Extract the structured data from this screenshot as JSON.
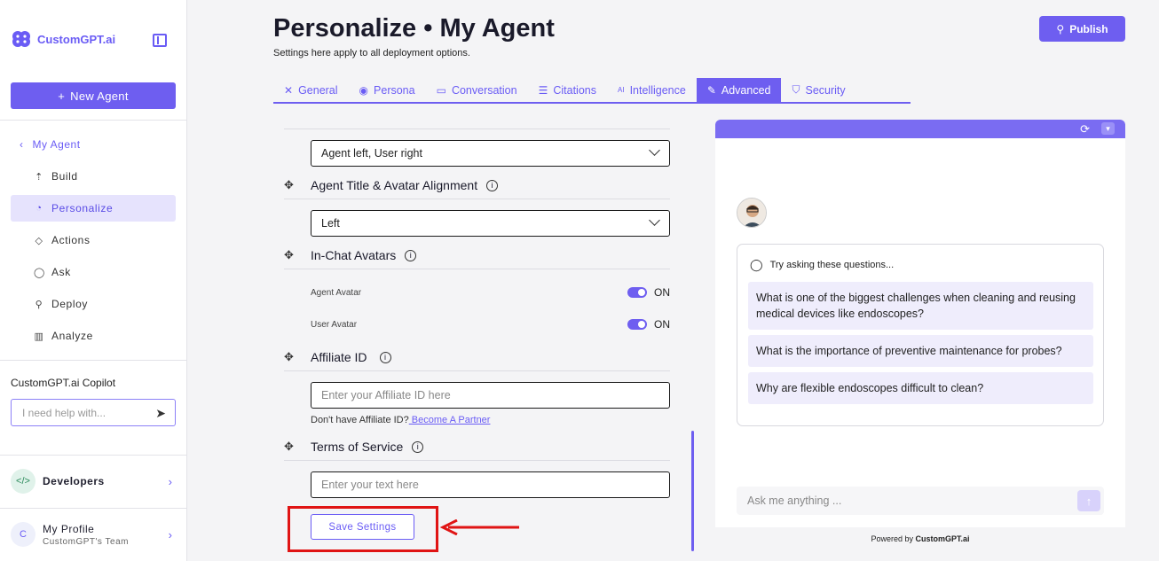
{
  "sidebar": {
    "logo_text": "CustomGPT.ai",
    "new_agent_label": "New Agent",
    "back_label": "My Agent",
    "items": [
      {
        "label": "Build",
        "icon": "build-icon"
      },
      {
        "label": "Personalize",
        "icon": "palette-icon"
      },
      {
        "label": "Actions",
        "icon": "actions-icon"
      },
      {
        "label": "Ask",
        "icon": "chat-icon"
      },
      {
        "label": "Deploy",
        "icon": "rocket-icon"
      },
      {
        "label": "Analyze",
        "icon": "chart-icon"
      }
    ],
    "active_item": "Personalize",
    "copilot_title": "CustomGPT.ai Copilot",
    "copilot_placeholder": "I need help with...",
    "developers_label": "Developers",
    "profile_initial": "C",
    "profile_name": "My Profile",
    "profile_team": "CustomGPT's Team"
  },
  "header": {
    "title": "Personalize • My Agent",
    "subtitle": "Settings here apply to all deployment options.",
    "publish_label": "Publish"
  },
  "tabs": [
    {
      "label": "General",
      "icon": "wand-icon"
    },
    {
      "label": "Persona",
      "icon": "user-circle-icon"
    },
    {
      "label": "Conversation",
      "icon": "message-icon"
    },
    {
      "label": "Citations",
      "icon": "list-icon"
    },
    {
      "label": "Intelligence",
      "icon": "ai-icon"
    },
    {
      "label": "Advanced",
      "icon": "wrench-icon"
    },
    {
      "label": "Security",
      "icon": "shield-icon"
    }
  ],
  "active_tab": "Advanced",
  "form": {
    "message_alignment_value": "Agent left, User right",
    "title_alignment_label": "Agent Title & Avatar Alignment",
    "title_alignment_value": "Left",
    "avatars_label": "In-Chat Avatars",
    "agent_avatar_label": "Agent Avatar",
    "agent_avatar_state": "ON",
    "user_avatar_label": "User Avatar",
    "user_avatar_state": "ON",
    "affiliate_label": "Affiliate ID",
    "affiliate_placeholder": "Enter your Affiliate ID here",
    "affiliate_hint": "Don't have Affiliate ID?",
    "affiliate_link": " Become A Partner",
    "terms_label": "Terms of Service",
    "terms_placeholder": "Enter your text here",
    "save_label": "Save Settings"
  },
  "preview": {
    "suggest_heading": "Try asking these questions...",
    "questions": [
      "What is one of the biggest challenges when cleaning and reusing medical devices like endoscopes?",
      "What is the importance of preventive maintenance for probes?",
      "Why are flexible endoscopes difficult to clean?"
    ],
    "ask_placeholder": "Ask me anything ...",
    "powered_prefix": "Powered by",
    "powered_brand": "CustomGPT.ai"
  },
  "colors": {
    "accent": "#6e5ef0",
    "highlight": "#e01414"
  }
}
